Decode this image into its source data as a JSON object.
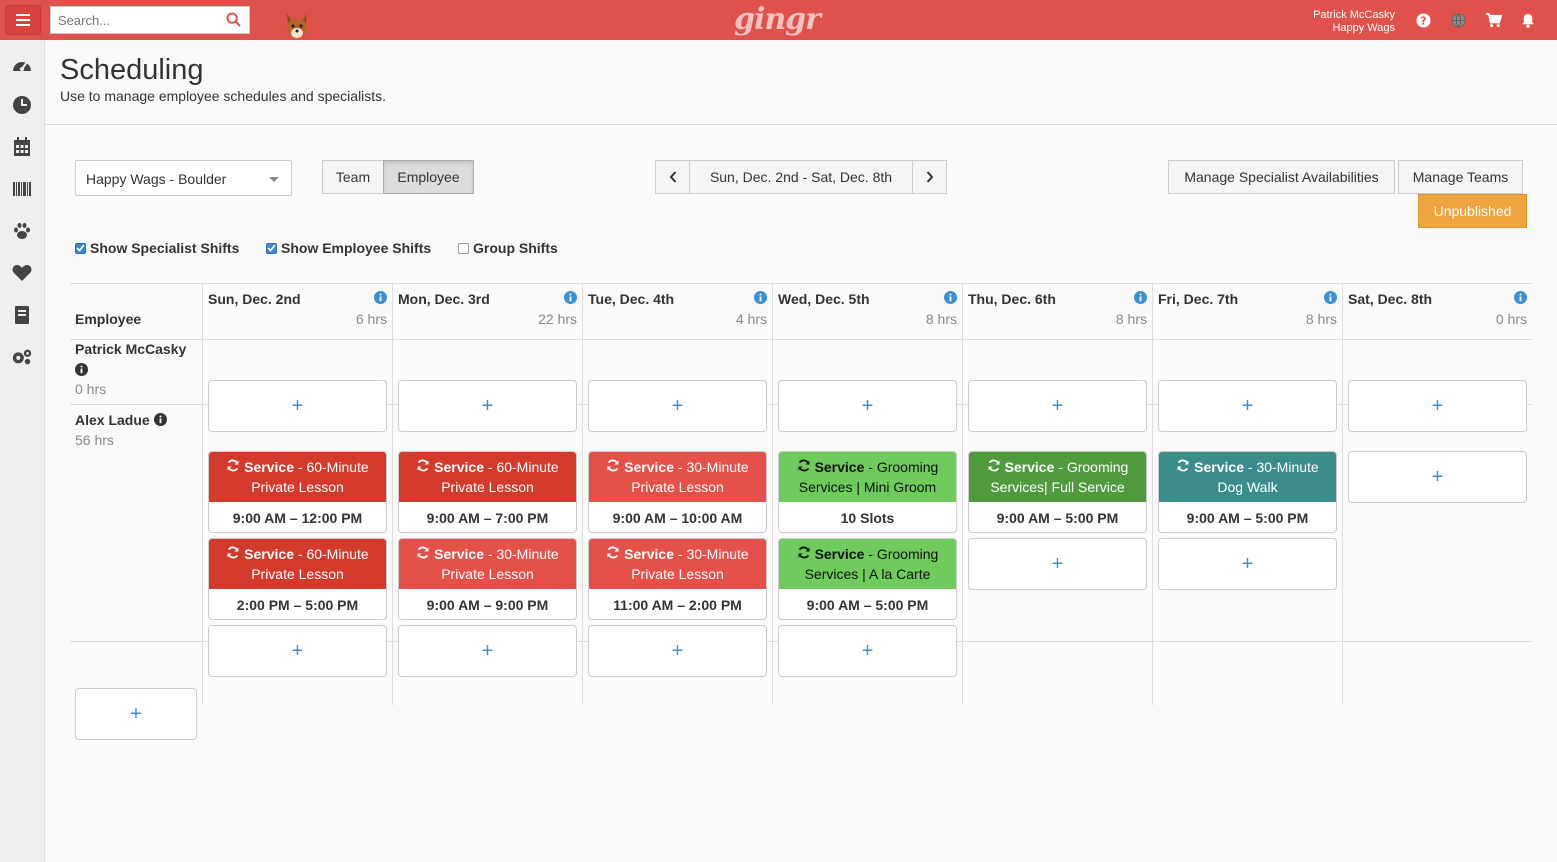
{
  "topbar": {
    "search_placeholder": "Search...",
    "logo": "gingr",
    "user_name": "Patrick McCasky",
    "business_name": "Happy Wags",
    "icons": [
      "question-circle-icon",
      "globe-icon",
      "cart-icon",
      "bell-icon"
    ]
  },
  "sidebar": {
    "items": [
      "dashboard-icon",
      "clock-icon",
      "calendar-icon",
      "barcode-icon",
      "paw-icon",
      "heart-icon",
      "book-icon",
      "cogs-icon"
    ]
  },
  "page": {
    "title": "Scheduling",
    "subtitle": "Use to manage employee schedules and specialists."
  },
  "controls": {
    "location": "Happy Wags - Boulder",
    "team_label": "Team",
    "employee_label": "Employee",
    "date_range": "Sun, Dec. 2nd - Sat, Dec. 8th",
    "manage_specialist_label": "Manage Specialist Availabilities",
    "manage_teams_label": "Manage Teams",
    "unpublished_label": "Unpublished"
  },
  "filters": {
    "show_specialist": "Show Specialist Shifts",
    "show_employee": "Show Employee Shifts",
    "group_shifts": "Group Shifts"
  },
  "grid": {
    "employee_header": "Employee",
    "days": [
      {
        "name": "Sun, Dec. 2nd",
        "hrs": "6 hrs"
      },
      {
        "name": "Mon, Dec. 3rd",
        "hrs": "22 hrs"
      },
      {
        "name": "Tue, Dec. 4th",
        "hrs": "4 hrs"
      },
      {
        "name": "Wed, Dec. 5th",
        "hrs": "8 hrs"
      },
      {
        "name": "Thu, Dec. 6th",
        "hrs": "8 hrs"
      },
      {
        "name": "Fri, Dec. 7th",
        "hrs": "8 hrs"
      },
      {
        "name": "Sat, Dec. 8th",
        "hrs": "0 hrs"
      }
    ],
    "employees": [
      {
        "name": "Patrick McCasky",
        "hrs": "0 hrs"
      },
      {
        "name": "Alex Ladue",
        "hrs": "56 hrs"
      }
    ],
    "add_symbol": "+",
    "shifts": {
      "sun1": {
        "label": "Service",
        "desc": " - 60-Minute Private Lesson",
        "time": "9:00 AM – 12:00 PM",
        "color": "#d33a2c"
      },
      "sun2": {
        "label": "Service",
        "desc": " - 60-Minute Private Lesson",
        "time": "2:00 PM – 5:00 PM",
        "color": "#d33a2c"
      },
      "mon1": {
        "label": "Service",
        "desc": " - 60-Minute Private Lesson",
        "time": "9:00 AM – 7:00 PM",
        "color": "#d33a2c"
      },
      "mon2": {
        "label": "Service",
        "desc": " - 30-Minute Private Lesson",
        "time": "9:00 AM – 9:00 PM",
        "color": "#e55048"
      },
      "tue1": {
        "label": "Service",
        "desc": " - 30-Minute Private Lesson",
        "time": "9:00 AM – 10:00 AM",
        "color": "#e55048"
      },
      "tue2": {
        "label": "Service",
        "desc": " - 30-Minute Private Lesson",
        "time": "11:00 AM – 2:00 PM",
        "color": "#e55048"
      },
      "wed1": {
        "label": "Service",
        "desc": " - Grooming Services | Mini Groom",
        "time": "10 Slots",
        "color": "#6fcb5c"
      },
      "wed2": {
        "label": "Service",
        "desc": " - Grooming Services | A la Carte",
        "time": "9:00 AM – 5:00 PM",
        "color": "#6fcb5c"
      },
      "thu1": {
        "label": "Service",
        "desc": " - Grooming Services| Full Service",
        "time": "9:00 AM – 5:00 PM",
        "color": "#4e9a3c"
      },
      "fri1": {
        "label": "Service",
        "desc": " - 30-Minute Dog Walk",
        "time": "9:00 AM – 5:00 PM",
        "color": "#3a8d8a"
      }
    }
  }
}
